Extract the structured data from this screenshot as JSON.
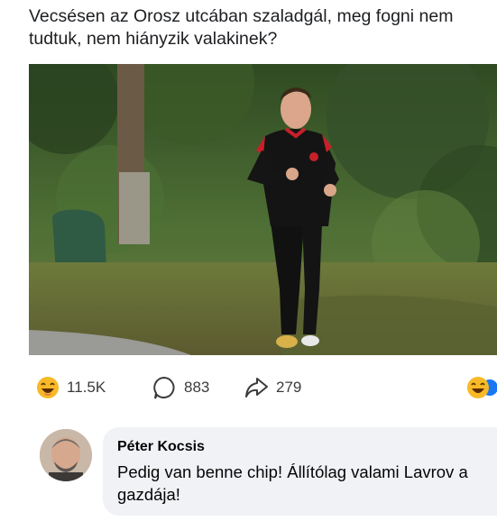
{
  "post": {
    "text": "Vecsésen az Orosz utcában szaladgál, meg fogni nem tudtuk, nem hiányzik valakinek?"
  },
  "actions": {
    "reactions_count": "11.5K",
    "comments_count": "883",
    "shares_count": "279"
  },
  "comment": {
    "author": "Péter Kocsis",
    "text": "Pedig van benne chip! Állítólag valami Lavrov a gazdája!"
  },
  "icons": {
    "reaction": "laughing-emoji-icon",
    "comment": "comment-bubble-icon",
    "share": "share-arrow-icon"
  },
  "colors": {
    "emoji_yellow": "#f7b928",
    "bubble_bg": "#f0f2f5",
    "text_secondary": "#3a3b3c"
  }
}
